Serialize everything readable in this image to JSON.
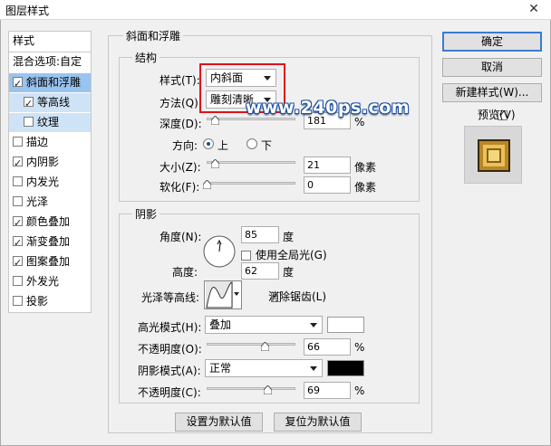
{
  "window": {
    "title": "图层样式",
    "close_glyph": "✕"
  },
  "sidebar": {
    "header": "样式",
    "blend_options": "混合选项:自定",
    "items": [
      {
        "label": "斜面和浮雕",
        "checked": true,
        "state": "selected"
      },
      {
        "label": "等高线",
        "checked": true,
        "state": "sub"
      },
      {
        "label": "纹理",
        "checked": false,
        "state": "sub"
      },
      {
        "label": "描边",
        "checked": false
      },
      {
        "label": "内阴影",
        "checked": true
      },
      {
        "label": "内发光",
        "checked": false
      },
      {
        "label": "光泽",
        "checked": false
      },
      {
        "label": "颜色叠加",
        "checked": true
      },
      {
        "label": "渐变叠加",
        "checked": true
      },
      {
        "label": "图案叠加",
        "checked": true
      },
      {
        "label": "外发光",
        "checked": false
      },
      {
        "label": "投影",
        "checked": false
      }
    ]
  },
  "bevel": {
    "group_title": "斜面和浮雕",
    "structure_title": "结构",
    "style_label": "样式(T):",
    "style_value": "内斜面",
    "method_label": "方法(Q):",
    "method_value": "雕刻清晰",
    "depth_label": "深度(D):",
    "depth_value": "181",
    "depth_unit": "%",
    "direction_label": "方向:",
    "direction_up": "上",
    "direction_down": "下",
    "direction_selected": "up",
    "size_label": "大小(Z):",
    "size_value": "21",
    "size_unit": "像素",
    "soften_label": "软化(F):",
    "soften_value": "0",
    "soften_unit": "像素"
  },
  "shading": {
    "group_title": "阴影",
    "angle_label": "角度(N):",
    "angle_value": "85",
    "angle_unit": "度",
    "global_light_label": "使用全局光(G)",
    "global_light_checked": false,
    "altitude_label": "高度:",
    "altitude_value": "62",
    "altitude_unit": "度",
    "gloss_contour_label": "光泽等高线:",
    "antialias_label": "消除锯齿(L)",
    "antialias_checked": true,
    "highlight_mode_label": "高光模式(H):",
    "highlight_mode_value": "叠加",
    "highlight_color": "#ffffff",
    "highlight_opacity_label": "不透明度(O):",
    "highlight_opacity_value": "66",
    "highlight_opacity_unit": "%",
    "shadow_mode_label": "阴影模式(A):",
    "shadow_mode_value": "正常",
    "shadow_color": "#000000",
    "shadow_opacity_label": "不透明度(C):",
    "shadow_opacity_value": "69",
    "shadow_opacity_unit": "%"
  },
  "footer": {
    "set_default": "设置为默认值",
    "reset_default": "复位为默认值"
  },
  "actions": {
    "ok": "确定",
    "cancel": "取消",
    "new_style": "新建样式(W)...",
    "preview_label": "预览(V)",
    "preview_checked": true
  },
  "watermark": "www.240ps.com",
  "slider_levels": {
    "depth": 0.1,
    "size": 0.1,
    "soften": 0.0,
    "highlight_opacity": 0.66,
    "shadow_opacity": 0.69
  },
  "colors": {
    "accent": "#3a7bd5",
    "selection": "#99c4f0",
    "red_highlight": "#e0101c"
  }
}
